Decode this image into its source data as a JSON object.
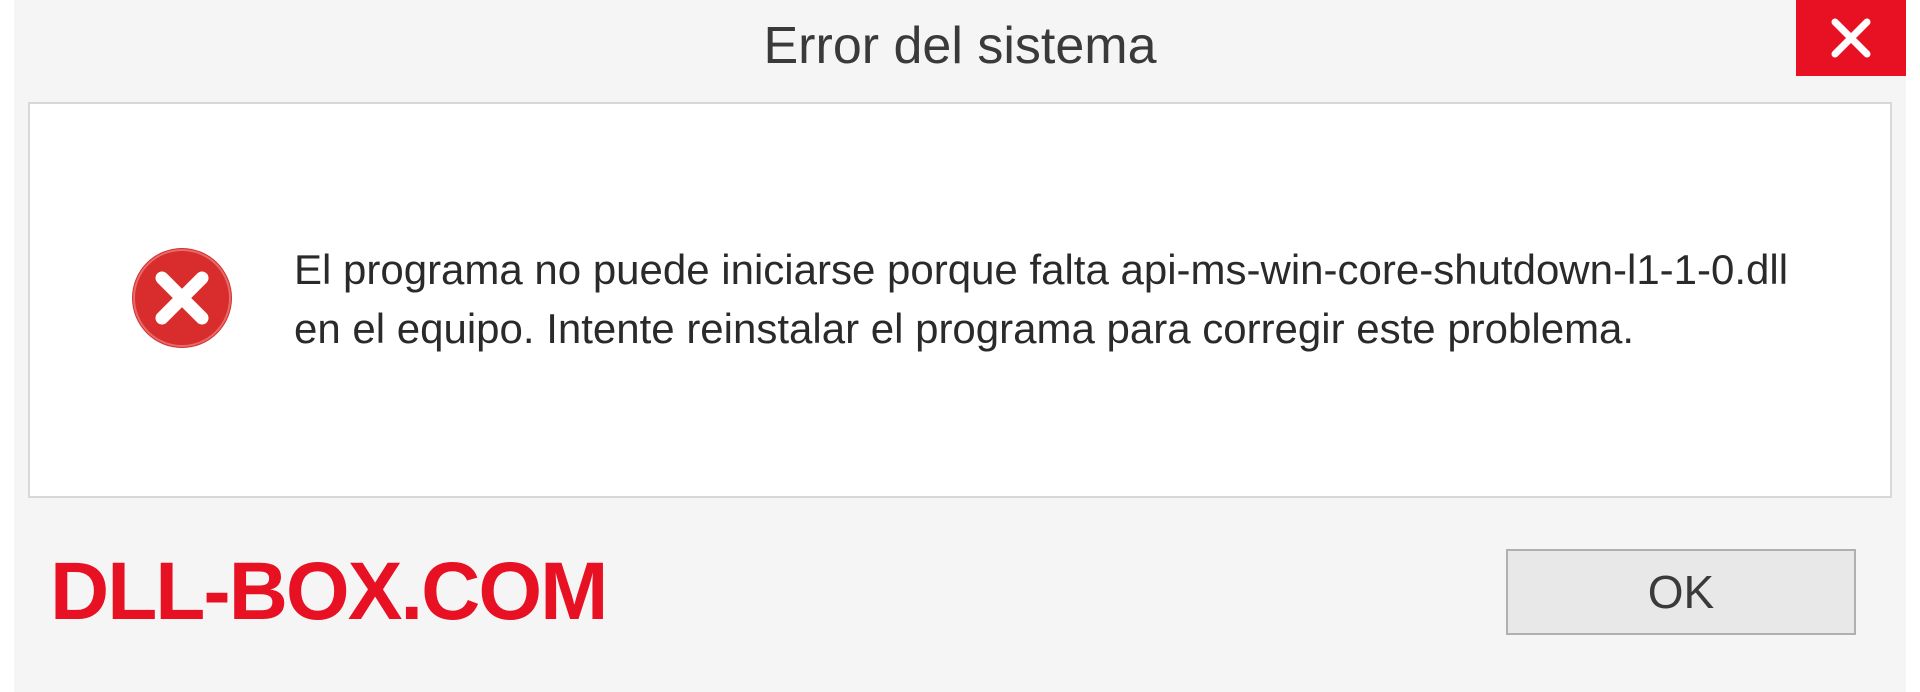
{
  "dialog": {
    "title": "Error del sistema",
    "message": "El programa no puede iniciarse porque falta api-ms-win-core-shutdown-l1-1-0.dll en el equipo. Intente reinstalar el programa para corregir este problema.",
    "ok_label": "OK"
  },
  "watermark": {
    "text": "DLL-BOX.COM"
  },
  "colors": {
    "close_button": "#e81123",
    "error_icon": "#d92c2c",
    "watermark": "#e81123"
  }
}
